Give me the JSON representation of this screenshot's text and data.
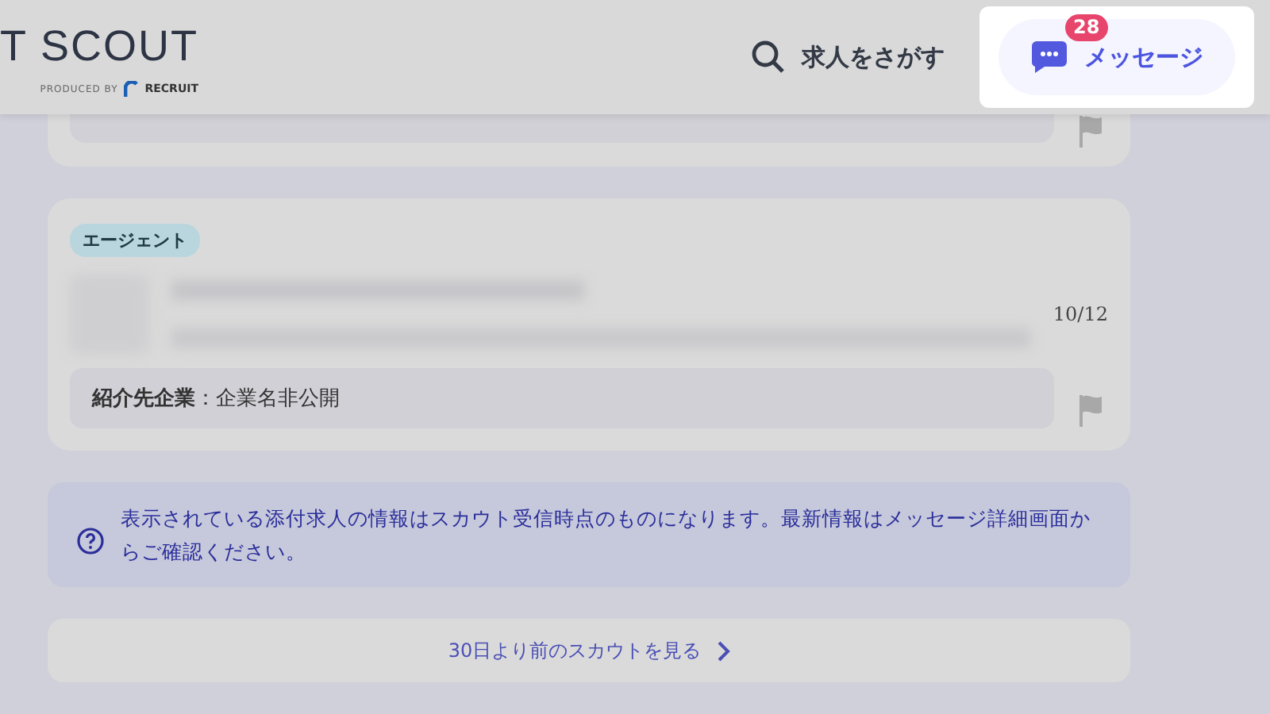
{
  "header": {
    "logo": "T SCOUT",
    "produced_by": "PRODUCED BY",
    "brand": "RECRUIT",
    "search_link": "求人をさがす",
    "messages": {
      "label": "メッセージ",
      "count": "28",
      "highlighted": true
    }
  },
  "scouts": [
    {
      "kind": "partial"
    },
    {
      "kind": "full",
      "tag": "エージェント",
      "date": "10/12",
      "company_label": "紹介先企業",
      "separator": "：",
      "company": "企業名非公開"
    }
  ],
  "notice": "表示されている添付求人の情報はスカウト受信時点のものになります。最新情報はメッセージ詳細画面からご確認ください。",
  "more_link": "30日より前のスカウトを見る"
}
